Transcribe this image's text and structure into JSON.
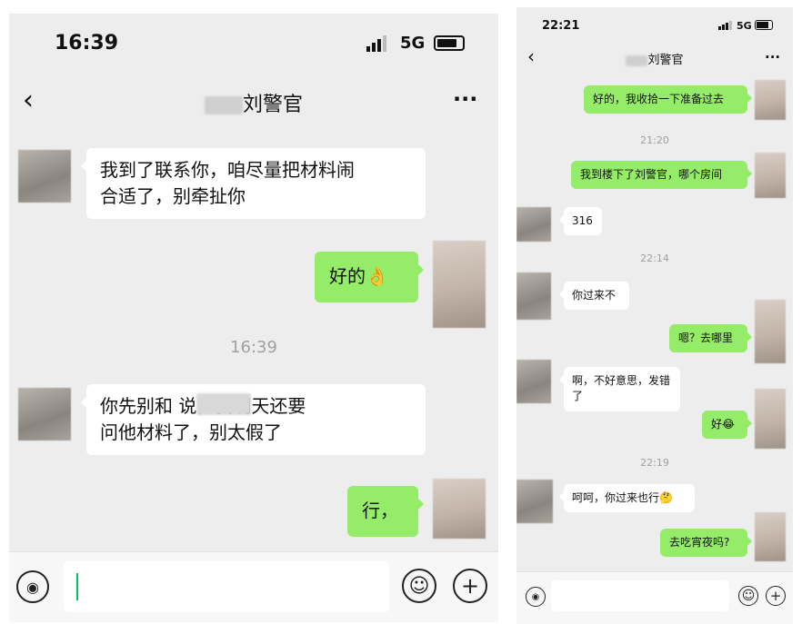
{
  "left": {
    "status_time": "16:39",
    "network": "5G",
    "title": "刘警官",
    "messages": [
      {
        "from": "other",
        "lines": [
          "我到了联系你，咱尽量把材料闹",
          "合适了，别牵扯你"
        ]
      },
      {
        "from": "me",
        "text": "好的👌"
      },
      {
        "type": "time",
        "text": "16:39"
      },
      {
        "from": "other",
        "lines": [
          "你先别和      说，我明天还要",
          "问他材料了，别太假了"
        ]
      },
      {
        "from": "me",
        "text": "行，"
      }
    ]
  },
  "right": {
    "status_time": "22:21",
    "network": "5G",
    "title": "刘警官",
    "messages": [
      {
        "from": "me",
        "text": "好的，我收拾一下准备过去"
      },
      {
        "type": "time",
        "text": "21:20"
      },
      {
        "from": "me",
        "text": "我到楼下了刘警官，哪个房间"
      },
      {
        "from": "other",
        "text": "316"
      },
      {
        "type": "time",
        "text": "22:14"
      },
      {
        "from": "other",
        "text": "你过来不"
      },
      {
        "from": "me",
        "text": "嗯？去哪里"
      },
      {
        "from": "other",
        "text": "啊，不好意思，发错了"
      },
      {
        "from": "me",
        "text": "好😂"
      },
      {
        "type": "time",
        "text": "22:19"
      },
      {
        "from": "other",
        "text": "呵呵，你过来也行🤔"
      },
      {
        "from": "me",
        "text": "去吃宵夜吗?"
      }
    ]
  },
  "icons": {
    "back": "back-icon",
    "more": "more-icon",
    "voice": "voice-icon",
    "emoji": "emoji-icon",
    "plus": "plus-icon"
  },
  "colors": {
    "bg": "#ededed",
    "out_bubble": "#95ec69",
    "in_bubble": "#ffffff",
    "cursor": "#07c160"
  }
}
